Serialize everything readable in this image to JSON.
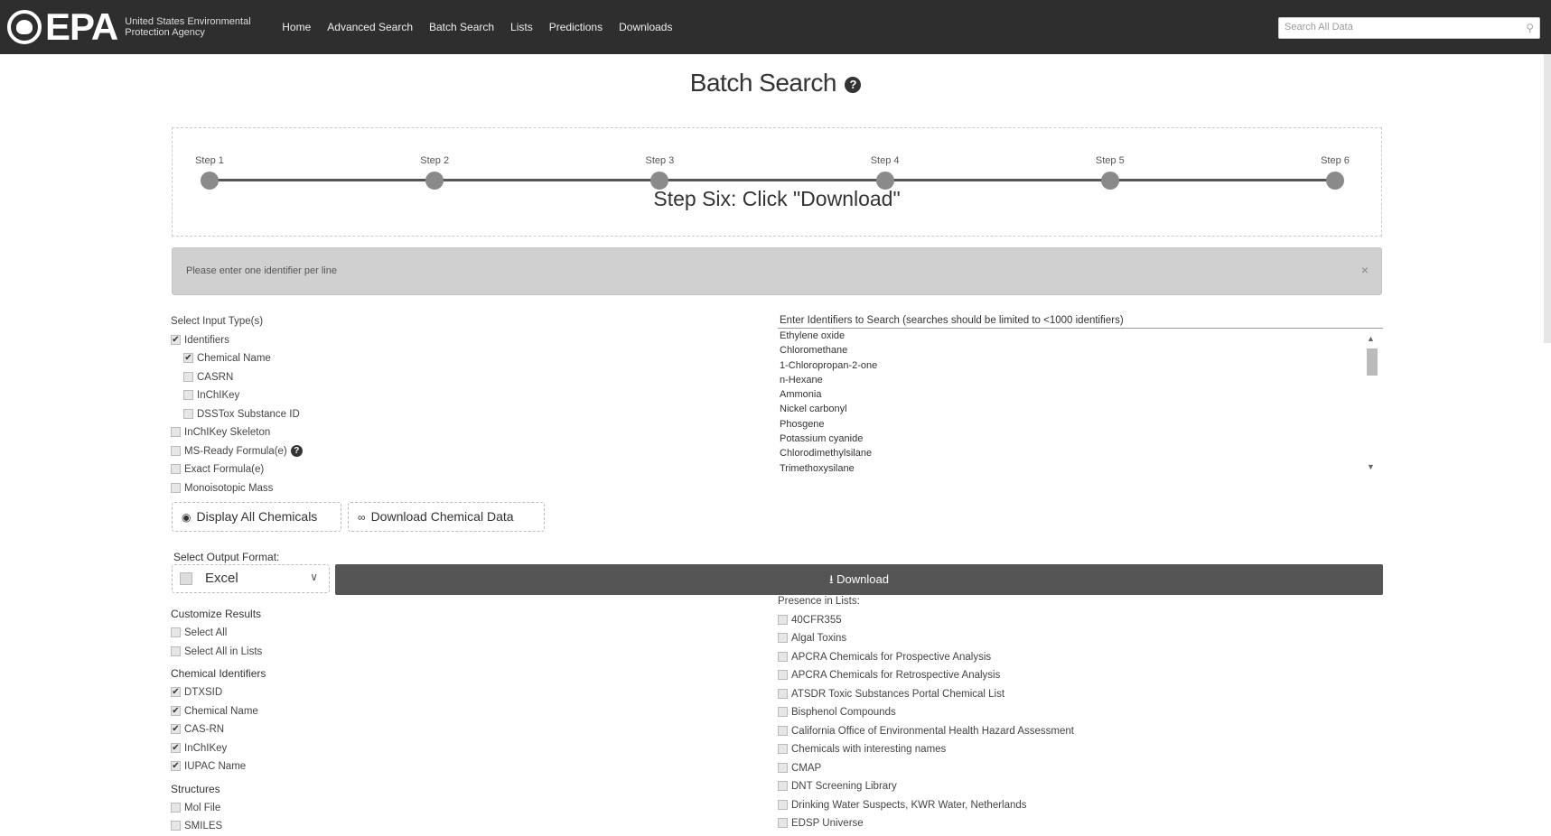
{
  "header": {
    "logo_text": "EPA",
    "agency_name": "United States Environmental Protection Agency",
    "nav": [
      "Home",
      "Advanced Search",
      "Batch Search",
      "Lists",
      "Predictions",
      "Downloads"
    ],
    "search_placeholder": "Search All Data"
  },
  "page_title": "Batch Search",
  "help_glyph": "?",
  "stepper": {
    "steps": [
      "Step 1",
      "Step 2",
      "Step 3",
      "Step 4",
      "Step 5",
      "Step 6"
    ],
    "caption": "Step Six: Click \"Download\""
  },
  "alert": {
    "text": "Please enter one identifier per line",
    "close": "×"
  },
  "input_types": {
    "title": "Select Input Type(s)",
    "items": [
      {
        "label": "Identifiers",
        "checked": true,
        "indent": false
      },
      {
        "label": "Chemical Name",
        "checked": true,
        "indent": true
      },
      {
        "label": "CASRN",
        "checked": false,
        "indent": true
      },
      {
        "label": "InChIKey",
        "checked": false,
        "indent": true
      },
      {
        "label": "DSSTox Substance ID",
        "checked": false,
        "indent": true
      },
      {
        "label": "InChIKey Skeleton",
        "checked": false,
        "indent": false
      },
      {
        "label": "MS-Ready Formula(e)",
        "checked": false,
        "indent": false,
        "help": true
      },
      {
        "label": "Exact Formula(e)",
        "checked": false,
        "indent": false
      },
      {
        "label": "Monoisotopic Mass",
        "checked": false,
        "indent": false
      }
    ]
  },
  "identifiers": {
    "title": "Enter Identifiers to Search (searches should be limited to <1000 identifiers)",
    "values": [
      "Ethylene oxide",
      "Chloromethane",
      "1-Chloropropan-2-one",
      "n-Hexane",
      "Ammonia",
      "Nickel carbonyl",
      "Phosgene",
      "Potassium cyanide",
      "Chlorodimethylsilane",
      "Trimethoxysilane"
    ]
  },
  "buttons": {
    "display_all": "Display All Chemicals",
    "download_data": "Download Chemical Data",
    "download": "Download"
  },
  "output": {
    "label": "Select Output Format:",
    "selected": "Excel"
  },
  "customize": {
    "title": "Customize Results",
    "general": [
      {
        "label": "Select All",
        "checked": false
      },
      {
        "label": "Select All in Lists",
        "checked": false
      }
    ],
    "chem_ids_title": "Chemical Identifiers",
    "chem_ids": [
      {
        "label": "DTXSID",
        "checked": true
      },
      {
        "label": "Chemical Name",
        "checked": true
      },
      {
        "label": "CAS-RN",
        "checked": true
      },
      {
        "label": "InChIKey",
        "checked": true
      },
      {
        "label": "IUPAC Name",
        "checked": true
      }
    ],
    "structures_title": "Structures",
    "structures": [
      {
        "label": "Mol File",
        "checked": false
      },
      {
        "label": "SMILES",
        "checked": false
      }
    ]
  },
  "presence": {
    "title": "Presence in Lists:",
    "items": [
      "40CFR355",
      "Algal Toxins",
      "APCRA Chemicals for Prospective Analysis",
      "APCRA Chemicals for Retrospective Analysis",
      "ATSDR Toxic Substances Portal Chemical List",
      "Bisphenol Compounds",
      "California Office of Environmental Health Hazard Assessment",
      "Chemicals with interesting names",
      "CMAP",
      "DNT Screening Library",
      "Drinking Water Suspects, KWR Water, Netherlands",
      "EDSP Universe"
    ]
  }
}
